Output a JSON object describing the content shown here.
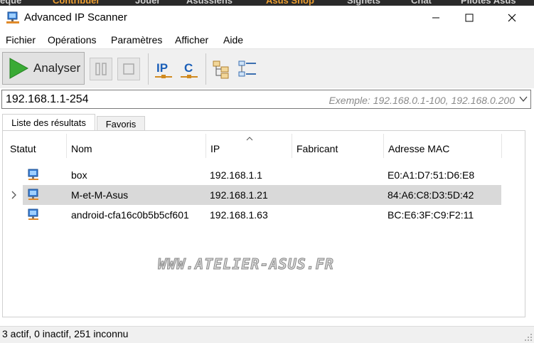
{
  "background_strip": {
    "words": [
      "eque",
      "Contribuer",
      "Jouer",
      "Asussiens",
      "Asus Shop",
      "Signets",
      "Chat",
      "Pilotes Asus"
    ]
  },
  "window": {
    "title": "Advanced IP Scanner"
  },
  "menu": {
    "items": [
      "Fichier",
      "Opérations",
      "Paramètres",
      "Afficher",
      "Aide"
    ]
  },
  "toolbar": {
    "scan_label": "Analyser",
    "ip_letters": "IP",
    "c_letter": "C"
  },
  "address": {
    "value": "192.168.1.1-254",
    "placeholder": "Exemple: 192.168.0.1-100, 192.168.0.200"
  },
  "tabs": {
    "results": "Liste des résultats",
    "favorites": "Favoris"
  },
  "columns": {
    "status": "Statut",
    "name": "Nom",
    "ip": "IP",
    "maker": "Fabricant",
    "mac": "Adresse MAC"
  },
  "rows": [
    {
      "name": "box",
      "ip": "192.168.1.1",
      "maker": "",
      "mac": "E0:A1:D7:51:D6:E8"
    },
    {
      "name": "M-et-M-Asus",
      "ip": "192.168.1.21",
      "maker": "",
      "mac": "84:A6:C8:D3:5D:42"
    },
    {
      "name": "android-cfa16c0b5b5cf601",
      "ip": "192.168.1.63",
      "maker": "",
      "mac": "BC:E6:3F:C9:F2:11"
    }
  ],
  "watermark": "WWW.ATELIER-ASUS.FR",
  "status": {
    "text": "3 actif, 0 inactif, 251 inconnu"
  },
  "colors": {
    "accent_green": "#3aaa35",
    "selected_row": "#d9d9d9",
    "toolbar_bg": "#f0f0f0"
  }
}
